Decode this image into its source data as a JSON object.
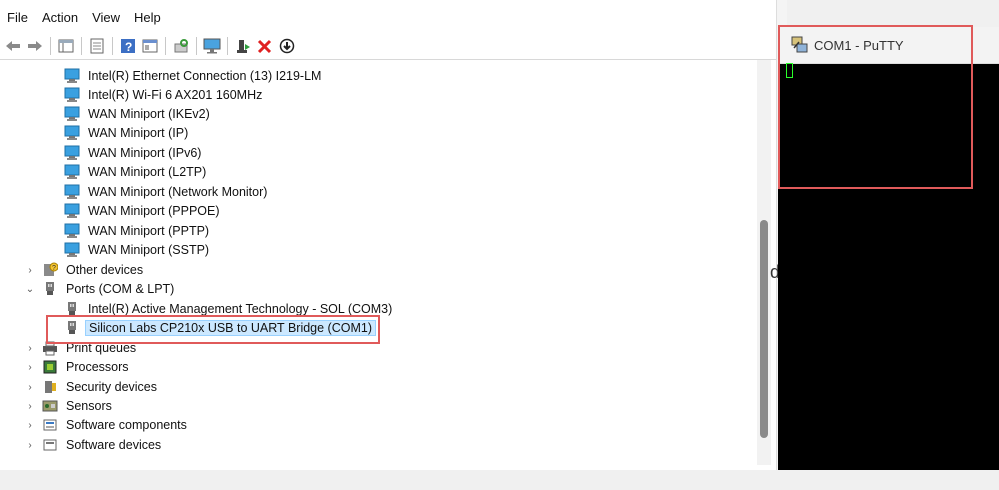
{
  "menu": [
    "File",
    "Action",
    "View",
    "Help"
  ],
  "toolbar_icons": [
    "back-arrow-icon",
    "forward-arrow-icon",
    "show-hide-tree-icon",
    "properties-icon",
    "help-icon",
    "view-icon",
    "scan-hardware-icon",
    "monitor-icon",
    "update-driver-icon",
    "uninstall-device-icon",
    "download-icon"
  ],
  "tree": {
    "network_adapters": [
      "Intel(R) Ethernet Connection (13) I219-LM",
      "Intel(R) Wi-Fi 6 AX201 160MHz",
      "WAN Miniport (IKEv2)",
      "WAN Miniport (IP)",
      "WAN Miniport (IPv6)",
      "WAN Miniport (L2TP)",
      "WAN Miniport (Network Monitor)",
      "WAN Miniport (PPPOE)",
      "WAN Miniport (PPTP)",
      "WAN Miniport (SSTP)"
    ],
    "other_devices": "Other devices",
    "ports": "Ports (COM & LPT)",
    "ports_children": [
      "Intel(R) Active Management Technology - SOL (COM3)",
      "Silicon Labs CP210x USB to UART Bridge (COM1)"
    ],
    "print_queues": "Print queues",
    "processors": "Processors",
    "security_devices": "Security devices",
    "sensors": "Sensors",
    "software_components": "Software components",
    "software_devices": "Software devices"
  },
  "putty": {
    "title": "COM1 - PuTTY"
  },
  "background_partial_text": "d",
  "colors": {
    "highlight": "#e05a5a",
    "selection": "#cce8ff",
    "terminal_cursor": "#2aff2a"
  }
}
